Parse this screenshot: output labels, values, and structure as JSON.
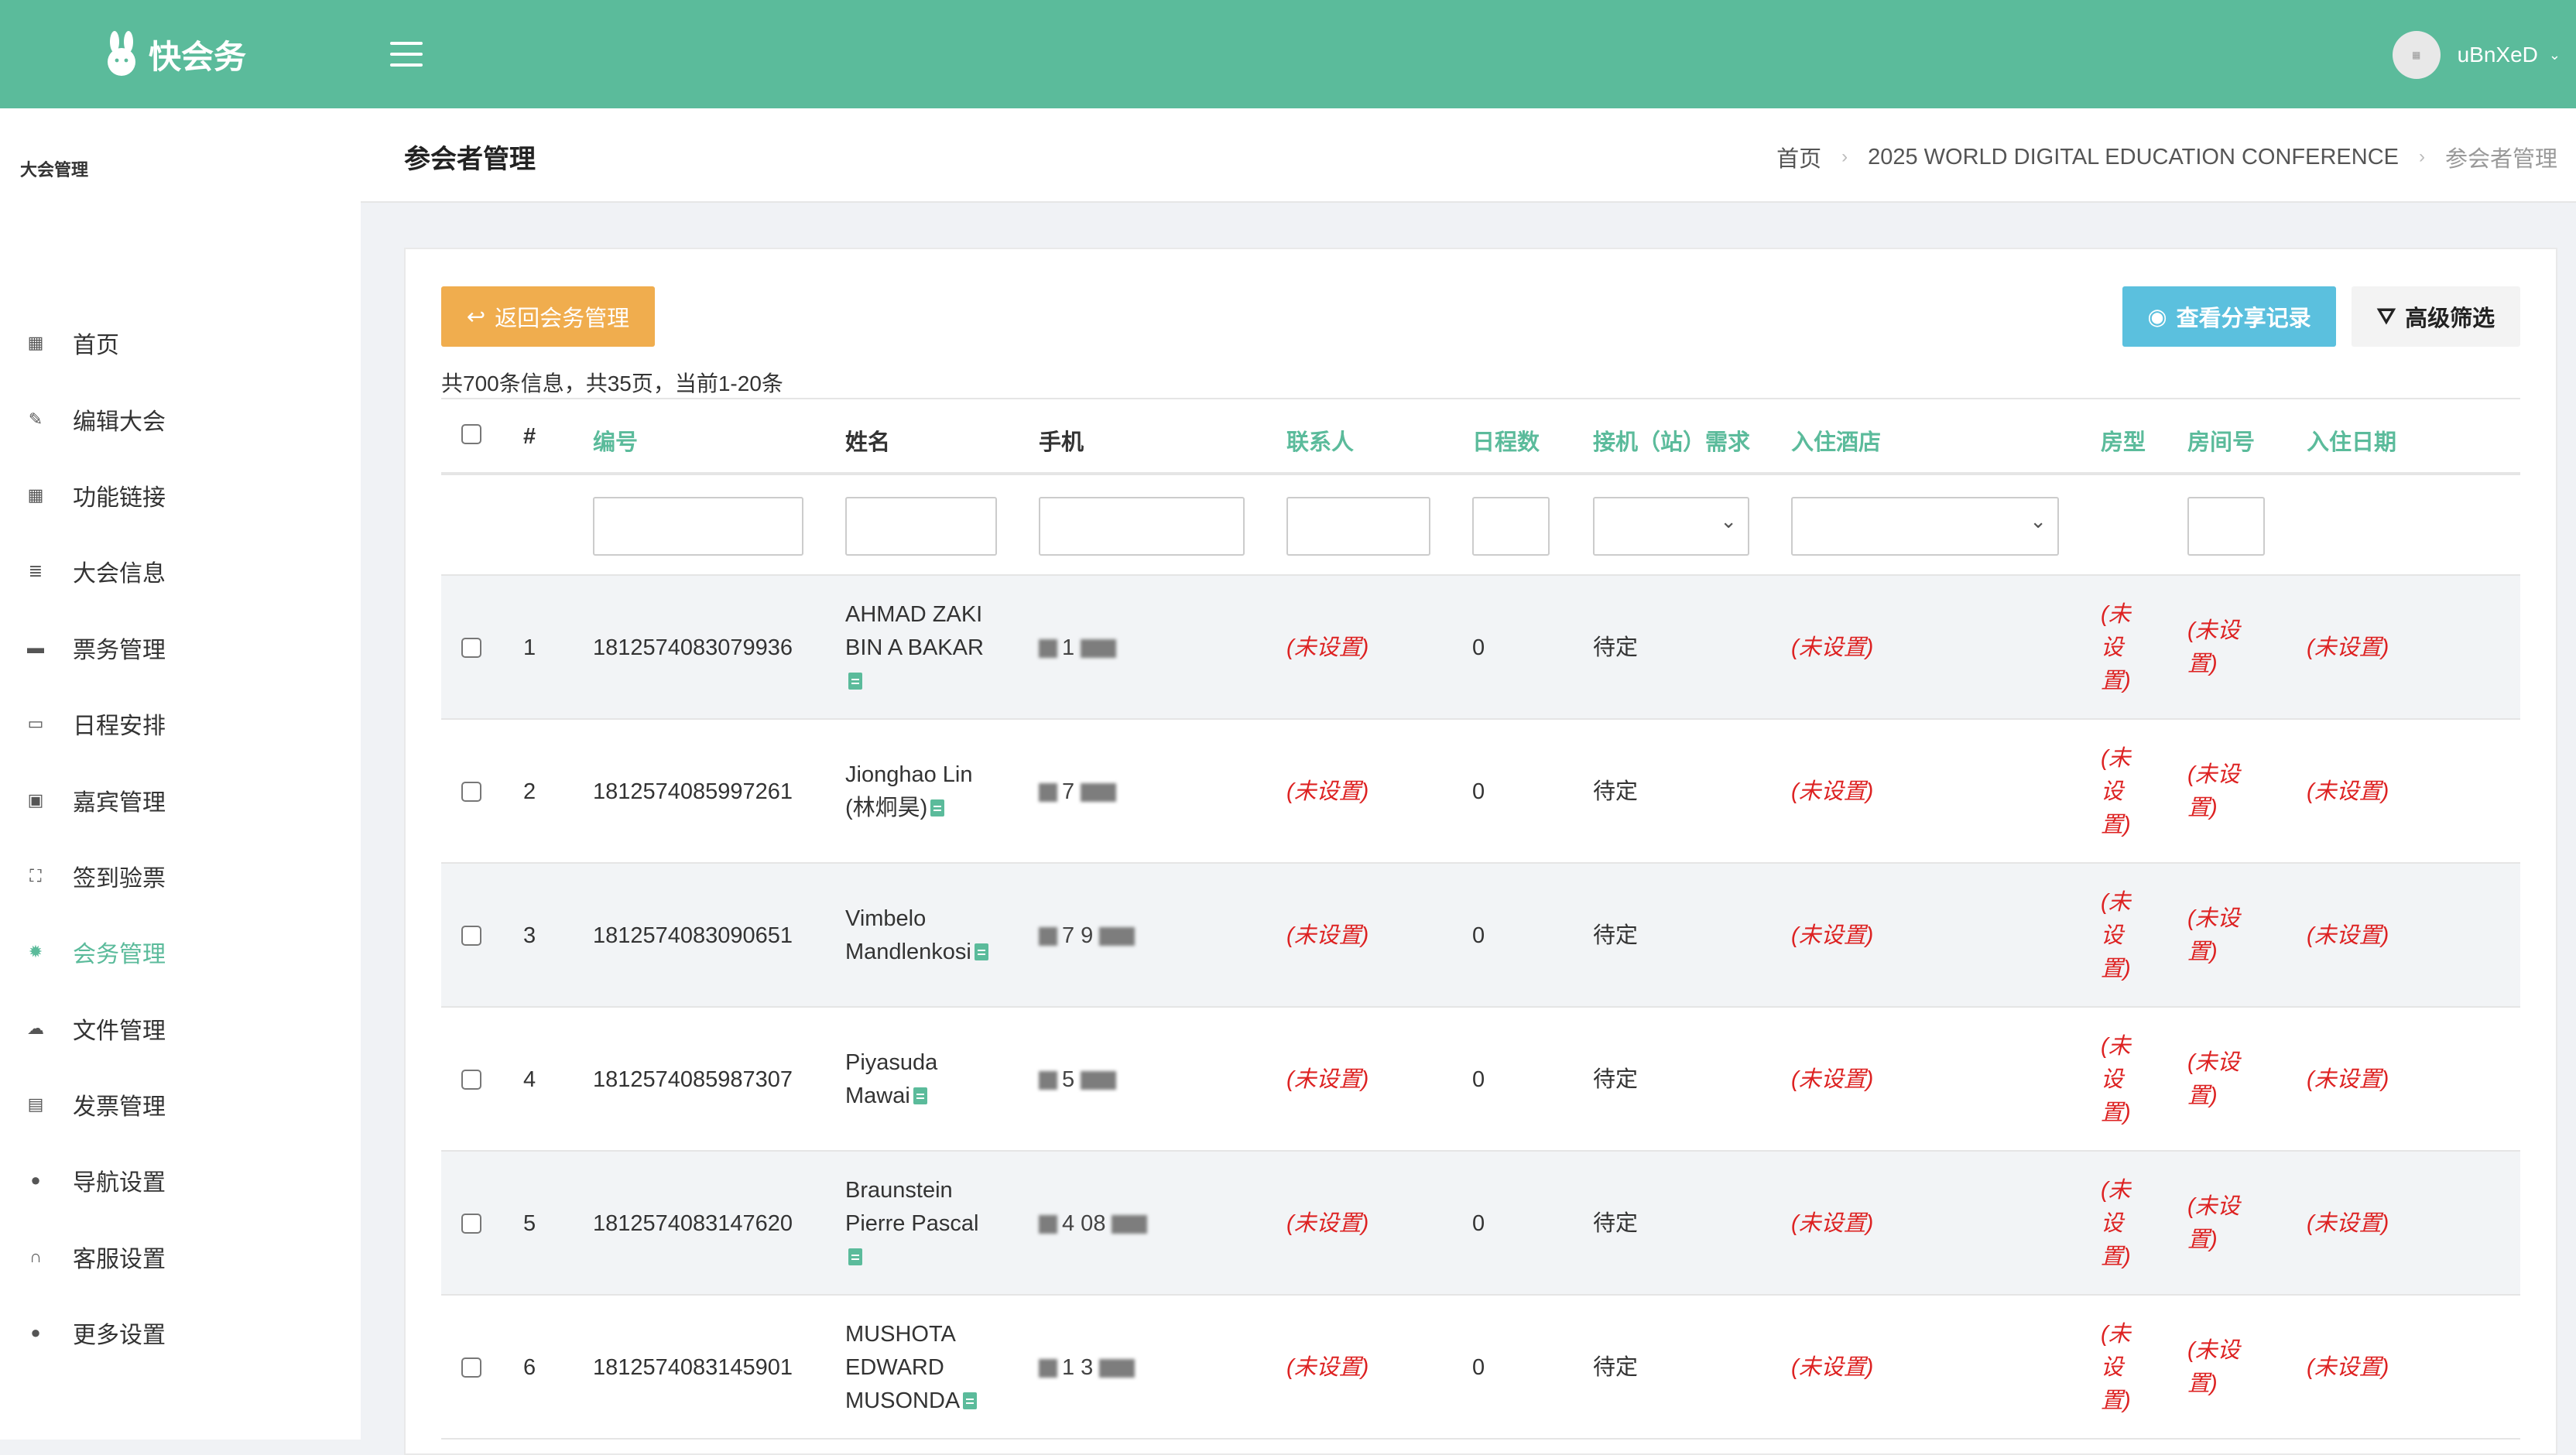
{
  "app": {
    "logo_text": "快会务",
    "user_name": "uBnXeD"
  },
  "sidebar": {
    "section": "大会管理",
    "items": [
      {
        "label": "首页",
        "icon": "dashboard-icon",
        "glyph": "▦",
        "active": false
      },
      {
        "label": "编辑大会",
        "icon": "edit-icon",
        "glyph": "✎",
        "active": false
      },
      {
        "label": "功能链接",
        "icon": "grid-icon",
        "glyph": "▦",
        "active": false
      },
      {
        "label": "大会信息",
        "icon": "list-icon",
        "glyph": "≣",
        "active": false
      },
      {
        "label": "票务管理",
        "icon": "ticket-icon",
        "glyph": "▬",
        "active": false
      },
      {
        "label": "日程安排",
        "icon": "calendar-icon",
        "glyph": "▭",
        "active": false
      },
      {
        "label": "嘉宾管理",
        "icon": "id-card-icon",
        "glyph": "▣",
        "active": false
      },
      {
        "label": "签到验票",
        "icon": "scan-icon",
        "glyph": "⛶",
        "active": false
      },
      {
        "label": "会务管理",
        "icon": "gear-icon",
        "glyph": "✹",
        "active": true
      },
      {
        "label": "文件管理",
        "icon": "cloud-upload-icon",
        "glyph": "☁",
        "active": false
      },
      {
        "label": "发票管理",
        "icon": "invoice-icon",
        "glyph": "▤",
        "active": false
      },
      {
        "label": "导航设置",
        "icon": "location-pin-icon",
        "glyph": "●",
        "active": false
      },
      {
        "label": "客服设置",
        "icon": "headset-icon",
        "glyph": "∩",
        "active": false
      },
      {
        "label": "更多设置",
        "icon": "more-icon",
        "glyph": "●",
        "active": false
      }
    ]
  },
  "page": {
    "title": "参会者管理",
    "breadcrumb": [
      "首页",
      "2025 WORLD DIGITAL EDUCATION CONFERENCE",
      "参会者管理"
    ]
  },
  "toolbar": {
    "back_label": "返回会务管理",
    "share_label": "查看分享记录",
    "filter_label": "高级筛选",
    "summary": "共700条信息，共35页，当前1-20条"
  },
  "table": {
    "headers": {
      "num": "#",
      "code": "编号",
      "name": "姓名",
      "phone": "手机",
      "contact": "联系人",
      "days": "日程数",
      "pickup": "接机（站）需求",
      "hotel": "入住酒店",
      "room_type": "房型",
      "room_no": "房间号",
      "checkin": "入住日期"
    },
    "rows": [
      {
        "num": "1",
        "code": "1812574083079936",
        "name_lines": [
          "AHMAD ZAKI",
          "BIN A BAKAR"
        ],
        "name_doc_on_own_line": true,
        "phone_visible": "1",
        "contact": "(未设置)",
        "days": "0",
        "pickup": "待定",
        "hotel": "(未设置)",
        "room_type_lines": [
          "(未",
          "设",
          "置)"
        ],
        "room_no_lines": [
          "(未设",
          "置)"
        ],
        "checkin": "(未设置)"
      },
      {
        "num": "2",
        "code": "1812574085997261",
        "name_lines": [
          "Jionghao Lin",
          "(林炯昊)"
        ],
        "name_doc_on_own_line": false,
        "phone_visible": "7",
        "contact": "(未设置)",
        "days": "0",
        "pickup": "待定",
        "hotel": "(未设置)",
        "room_type_lines": [
          "(未",
          "设",
          "置)"
        ],
        "room_no_lines": [
          "(未设",
          "置)"
        ],
        "checkin": "(未设置)"
      },
      {
        "num": "3",
        "code": "1812574083090651",
        "name_lines": [
          "Vimbelo",
          "Mandlenkosi"
        ],
        "name_doc_on_own_line": false,
        "phone_visible": "7 9",
        "contact": "(未设置)",
        "days": "0",
        "pickup": "待定",
        "hotel": "(未设置)",
        "room_type_lines": [
          "(未",
          "设",
          "置)"
        ],
        "room_no_lines": [
          "(未设",
          "置)"
        ],
        "checkin": "(未设置)"
      },
      {
        "num": "4",
        "code": "1812574085987307",
        "name_lines": [
          "Piyasuda",
          "Mawai"
        ],
        "name_doc_on_own_line": false,
        "phone_visible": "5",
        "contact": "(未设置)",
        "days": "0",
        "pickup": "待定",
        "hotel": "(未设置)",
        "room_type_lines": [
          "(未",
          "设",
          "置)"
        ],
        "room_no_lines": [
          "(未设",
          "置)"
        ],
        "checkin": "(未设置)"
      },
      {
        "num": "5",
        "code": "1812574083147620",
        "name_lines": [
          "Braunstein",
          "Pierre Pascal"
        ],
        "name_doc_on_own_line": true,
        "phone_visible": "4 08",
        "contact": "(未设置)",
        "days": "0",
        "pickup": "待定",
        "hotel": "(未设置)",
        "room_type_lines": [
          "(未",
          "设",
          "置)"
        ],
        "room_no_lines": [
          "(未设",
          "置)"
        ],
        "checkin": "(未设置)"
      },
      {
        "num": "6",
        "code": "1812574083145901",
        "name_lines": [
          "MUSHOTA",
          "EDWARD",
          "MUSONDA"
        ],
        "name_doc_on_own_line": false,
        "phone_visible": "1 3",
        "contact": "(未设置)",
        "days": "0",
        "pickup": "待定",
        "hotel": "(未设置)",
        "room_type_lines": [
          "(未",
          "设",
          "置)"
        ],
        "room_no_lines": [
          "(未设",
          "置)"
        ],
        "checkin": "(未设置)"
      }
    ]
  },
  "colors": {
    "brand": "#5bbb9b",
    "warning": "#f0ad4e",
    "info": "#5bc0de",
    "unset_text": "#dd2222"
  }
}
